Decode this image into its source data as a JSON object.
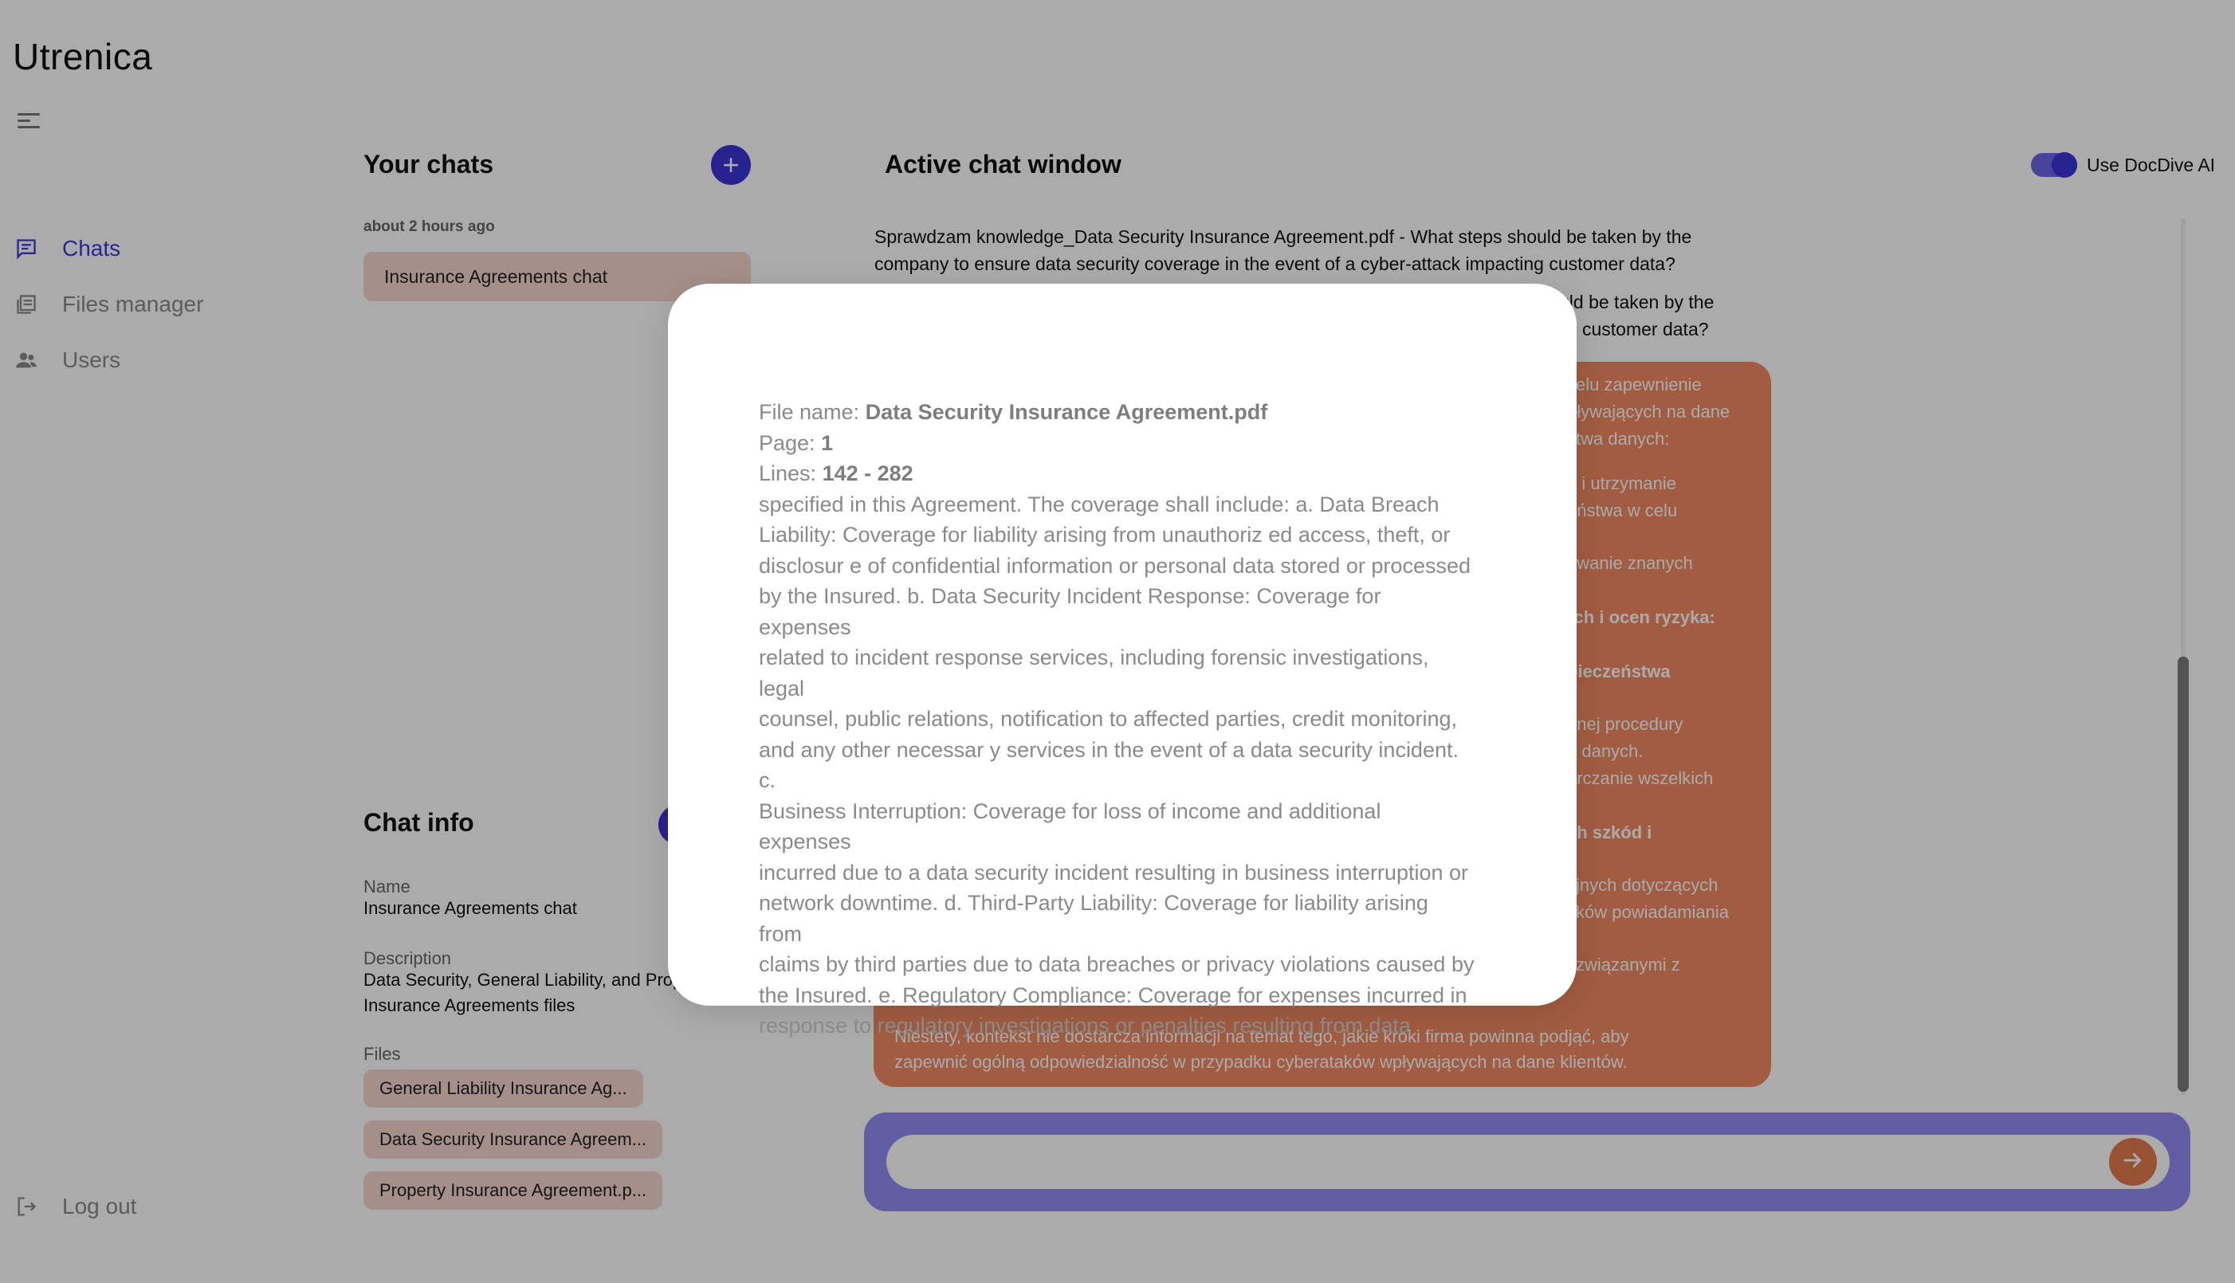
{
  "app": {
    "logo": "Utrenica"
  },
  "sidebar": {
    "items": [
      {
        "label": "Chats",
        "icon": "chat-icon",
        "active": true
      },
      {
        "label": "Files manager",
        "icon": "files-icon",
        "active": false
      },
      {
        "label": "Users",
        "icon": "users-icon",
        "active": false
      }
    ],
    "logout_label": "Log out"
  },
  "chats_panel": {
    "title": "Your chats",
    "group_label": "about 2 hours ago",
    "chats": [
      {
        "name": "Insurance Agreements chat"
      }
    ]
  },
  "chat_info": {
    "title": "Chat info",
    "name_label": "Name",
    "name_value": "Insurance Agreements chat",
    "description_label": "Description",
    "description_line1": "Data Security, General Liability, and Prop",
    "description_line2": "Insurance Agreements files",
    "files_label": "Files",
    "files": [
      "General Liability Insurance Ag...",
      "Data Security Insurance Agreem...",
      "Property Insurance Agreement.p..."
    ]
  },
  "active_chat": {
    "title": "Active chat window",
    "toggle_label": "Use DocDive AI",
    "toggle_on": true,
    "messages": {
      "status_line1": "Sprawdzam knowledge_Data Security Insurance Agreement.pdf - What steps should be taken by the",
      "status_line2": "company to ensure data security coverage in the event of a cyber-attack impacting customer data?",
      "user_line1": "uld be taken by the",
      "user_line2": "customer data?",
      "bot_fragments": [
        "celu zapewnienie",
        "pływających na dane",
        "stwa danych:",
        "e i utrzymanie",
        "eństwa w celu",
        "owanie znanych",
        "rch i ocen ryzyka:",
        "pieczeństwa",
        "onej procedury",
        "h danych.",
        "arczanie wszelkich",
        "ch szkód i",
        "yjnych dotyczących",
        "zków powiadamiania",
        ".",
        "i związanymi z"
      ],
      "bot_footer_line1": "Niestety, kontekst nie dostarcza informacji na temat tego, jakie kroki firma powinna podjąć, aby",
      "bot_footer_line2": "zapewnić ogólną odpowiedzialność w przypadku cyberataków wpływających na dane klientów."
    },
    "input_placeholder": ""
  },
  "modal": {
    "file_label": "File name:",
    "file_value": "Data Security Insurance Agreement.pdf",
    "page_label": "Page:",
    "page_value": "1",
    "lines_label": "Lines:",
    "lines_value": "142 - 282",
    "text_lines": [
      "specified in this Agreement. The coverage shall include: a. Data Breach",
      "Liability: Coverage for liability arising from unauthoriz ed access, theft, or",
      "disclosur e of confidential information or personal data stored or processed",
      "by the Insured. b. Data Security Incident Response: Coverage for expenses",
      "related to incident response services, including forensic investigations, legal",
      "counsel, public relations, notification to affected parties, credit monitoring,",
      "and any other necessar y services in the event of a data security incident. c.",
      "Business Interruption: Coverage for loss of income and additional expenses",
      "incurred due to a data security incident resulting in business interruption or",
      "network downtime. d. Third-Party Liability: Coverage for liability arising from",
      "claims by third parties due to data breaches or privacy violations caused by",
      "the Insured. e. Regulatory Compliance: Coverage for expenses incurred in",
      "response to regulatory investigations or penalties resulting from data"
    ]
  },
  "colors": {
    "accent": "#3a33d6",
    "bubble": "#f08a62",
    "chip": "#f7d5cd",
    "composer": "#8f8bf2",
    "overlay": "rgba(0,0,0,0.33)"
  }
}
